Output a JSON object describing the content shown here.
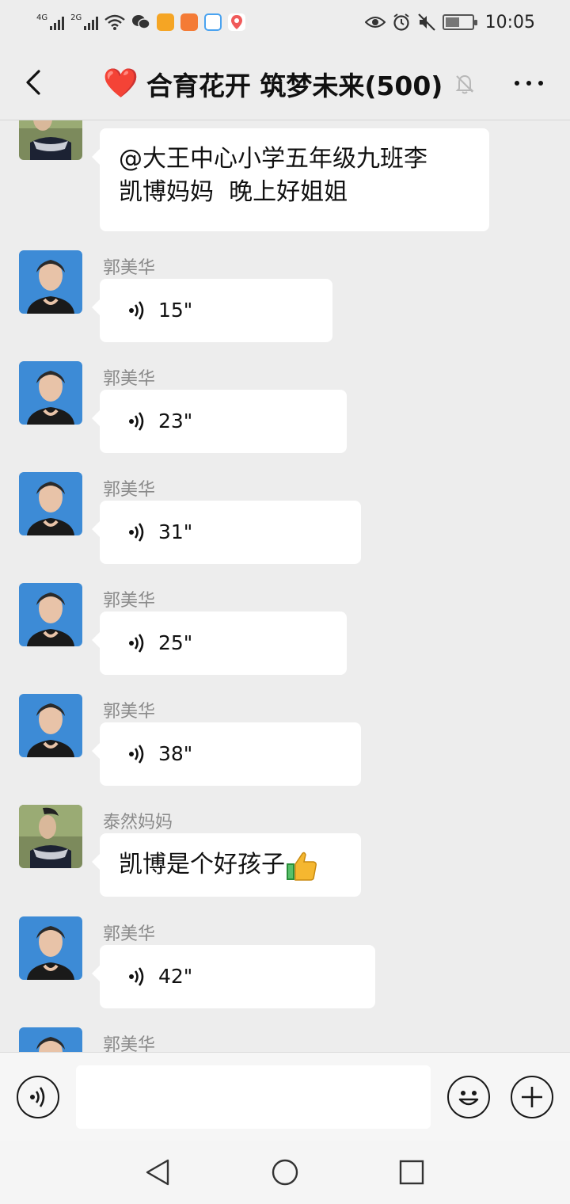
{
  "status_bar": {
    "time": "10:05",
    "signal1_label": "4G",
    "signal2_label": "2G",
    "battery_level": 0.55
  },
  "header": {
    "title": "合育花开 筑梦未来(500)",
    "title_emoji": "❤️",
    "back_icon": "chevron-left-icon",
    "mute_icon": "bell-off-icon",
    "more_icon": "more-dots-icon"
  },
  "messages": [
    {
      "type": "text",
      "avatar": "woman-ethnic-headdress-avatar",
      "text_line1": "@大王中心小学五年级九班李",
      "text_line2": "凯博妈妈  晚上好姐姐"
    },
    {
      "type": "voice",
      "sender": "郭美华",
      "duration": "15\""
    },
    {
      "type": "voice",
      "sender": "郭美华",
      "duration": "23\""
    },
    {
      "type": "voice",
      "sender": "郭美华",
      "duration": "31\""
    },
    {
      "type": "voice",
      "sender": "郭美华",
      "duration": "25\""
    },
    {
      "type": "voice",
      "sender": "郭美华",
      "duration": "38\""
    },
    {
      "type": "text",
      "sender": "泰然妈妈",
      "text": "凯博是个好孩子",
      "emoji": "thumbs-up-icon"
    },
    {
      "type": "voice",
      "sender": "郭美华",
      "duration": "42\""
    },
    {
      "type": "partial",
      "sender": "郭美华"
    }
  ],
  "input_bar": {
    "voice_icon": "voice-input-icon",
    "emoji_icon": "emoji-face-icon",
    "plus_icon": "plus-circle-icon",
    "input_value": ""
  },
  "system_nav": {
    "back_icon": "triangle-back-icon",
    "home_icon": "circle-home-icon",
    "recent_icon": "square-recents-icon"
  },
  "colors": {
    "background": "#ededed",
    "bubble": "#ffffff",
    "heart": "#e5202e",
    "sender_name": "#8a8a8a"
  }
}
